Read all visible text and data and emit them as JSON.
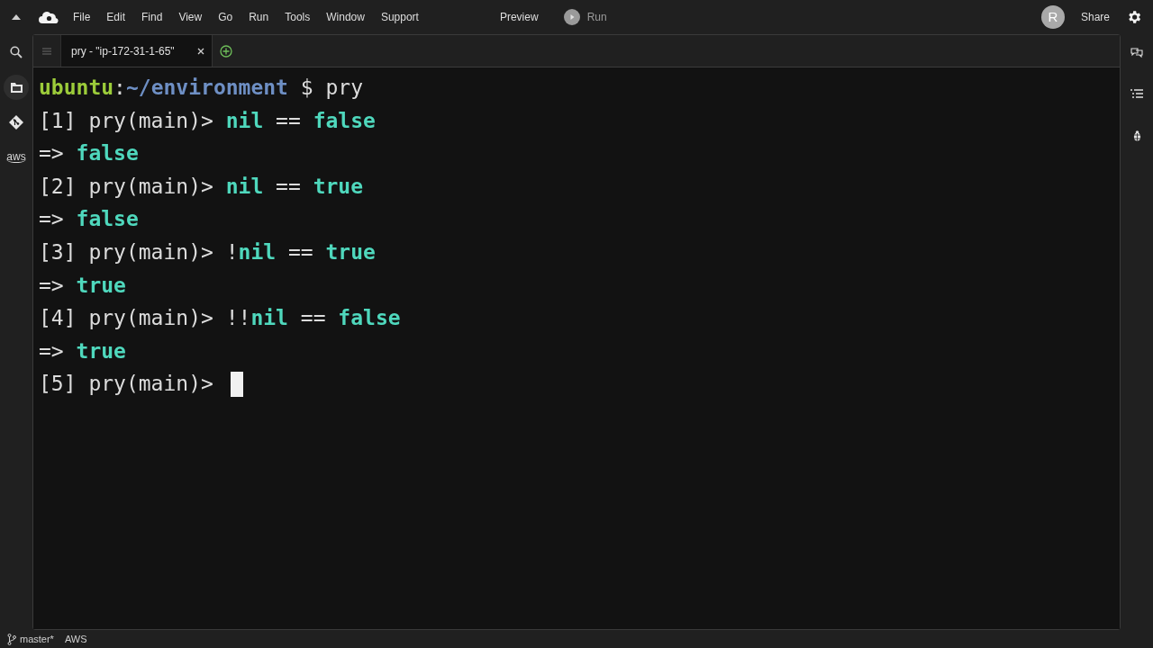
{
  "menu_bar": {
    "items": [
      "File",
      "Edit",
      "Find",
      "View",
      "Go",
      "Run",
      "Tools",
      "Window",
      "Support"
    ],
    "preview": "Preview",
    "run": "Run",
    "avatar": "R",
    "share": "Share"
  },
  "left_sidebar": {
    "items": [
      {
        "kind": "search",
        "selected": false
      },
      {
        "kind": "files",
        "selected": true
      },
      {
        "kind": "git",
        "selected": false
      },
      {
        "kind": "aws",
        "label": "aws",
        "selected": false
      }
    ]
  },
  "tabs": [
    {
      "label": "pry - \"ip-172-31-1-65\"",
      "selected": true
    }
  ],
  "terminal": {
    "lines": [
      [
        {
          "kind": "user",
          "text": "ubuntu"
        },
        {
          "kind": "plain",
          "text": ":"
        },
        {
          "kind": "path",
          "text": "~/environment"
        },
        {
          "kind": "plain",
          "text": " $ pry"
        }
      ],
      [
        {
          "kind": "plain",
          "text": "[1] pry(main)> "
        },
        {
          "kind": "value",
          "text": "nil"
        },
        {
          "kind": "plain",
          "text": " == "
        },
        {
          "kind": "value",
          "text": "false"
        }
      ],
      [
        {
          "kind": "plain",
          "text": "=> "
        },
        {
          "kind": "value",
          "text": "false"
        }
      ],
      [
        {
          "kind": "plain",
          "text": "[2] pry(main)> "
        },
        {
          "kind": "value",
          "text": "nil"
        },
        {
          "kind": "plain",
          "text": " == "
        },
        {
          "kind": "value",
          "text": "true"
        }
      ],
      [
        {
          "kind": "plain",
          "text": "=> "
        },
        {
          "kind": "value",
          "text": "false"
        }
      ],
      [
        {
          "kind": "plain",
          "text": "[3] pry(main)> !"
        },
        {
          "kind": "value",
          "text": "nil"
        },
        {
          "kind": "plain",
          "text": " == "
        },
        {
          "kind": "value",
          "text": "true"
        }
      ],
      [
        {
          "kind": "plain",
          "text": "=> "
        },
        {
          "kind": "value",
          "text": "true"
        }
      ],
      [
        {
          "kind": "plain",
          "text": "[4] pry(main)> !!"
        },
        {
          "kind": "value",
          "text": "nil"
        },
        {
          "kind": "plain",
          "text": " == "
        },
        {
          "kind": "value",
          "text": "false"
        }
      ],
      [
        {
          "kind": "plain",
          "text": "=> "
        },
        {
          "kind": "value",
          "text": "true"
        }
      ],
      [
        {
          "kind": "plain",
          "text": "[5] pry(main)> "
        }
      ]
    ]
  },
  "status_bar": {
    "branch": "master*",
    "aws": "AWS"
  }
}
